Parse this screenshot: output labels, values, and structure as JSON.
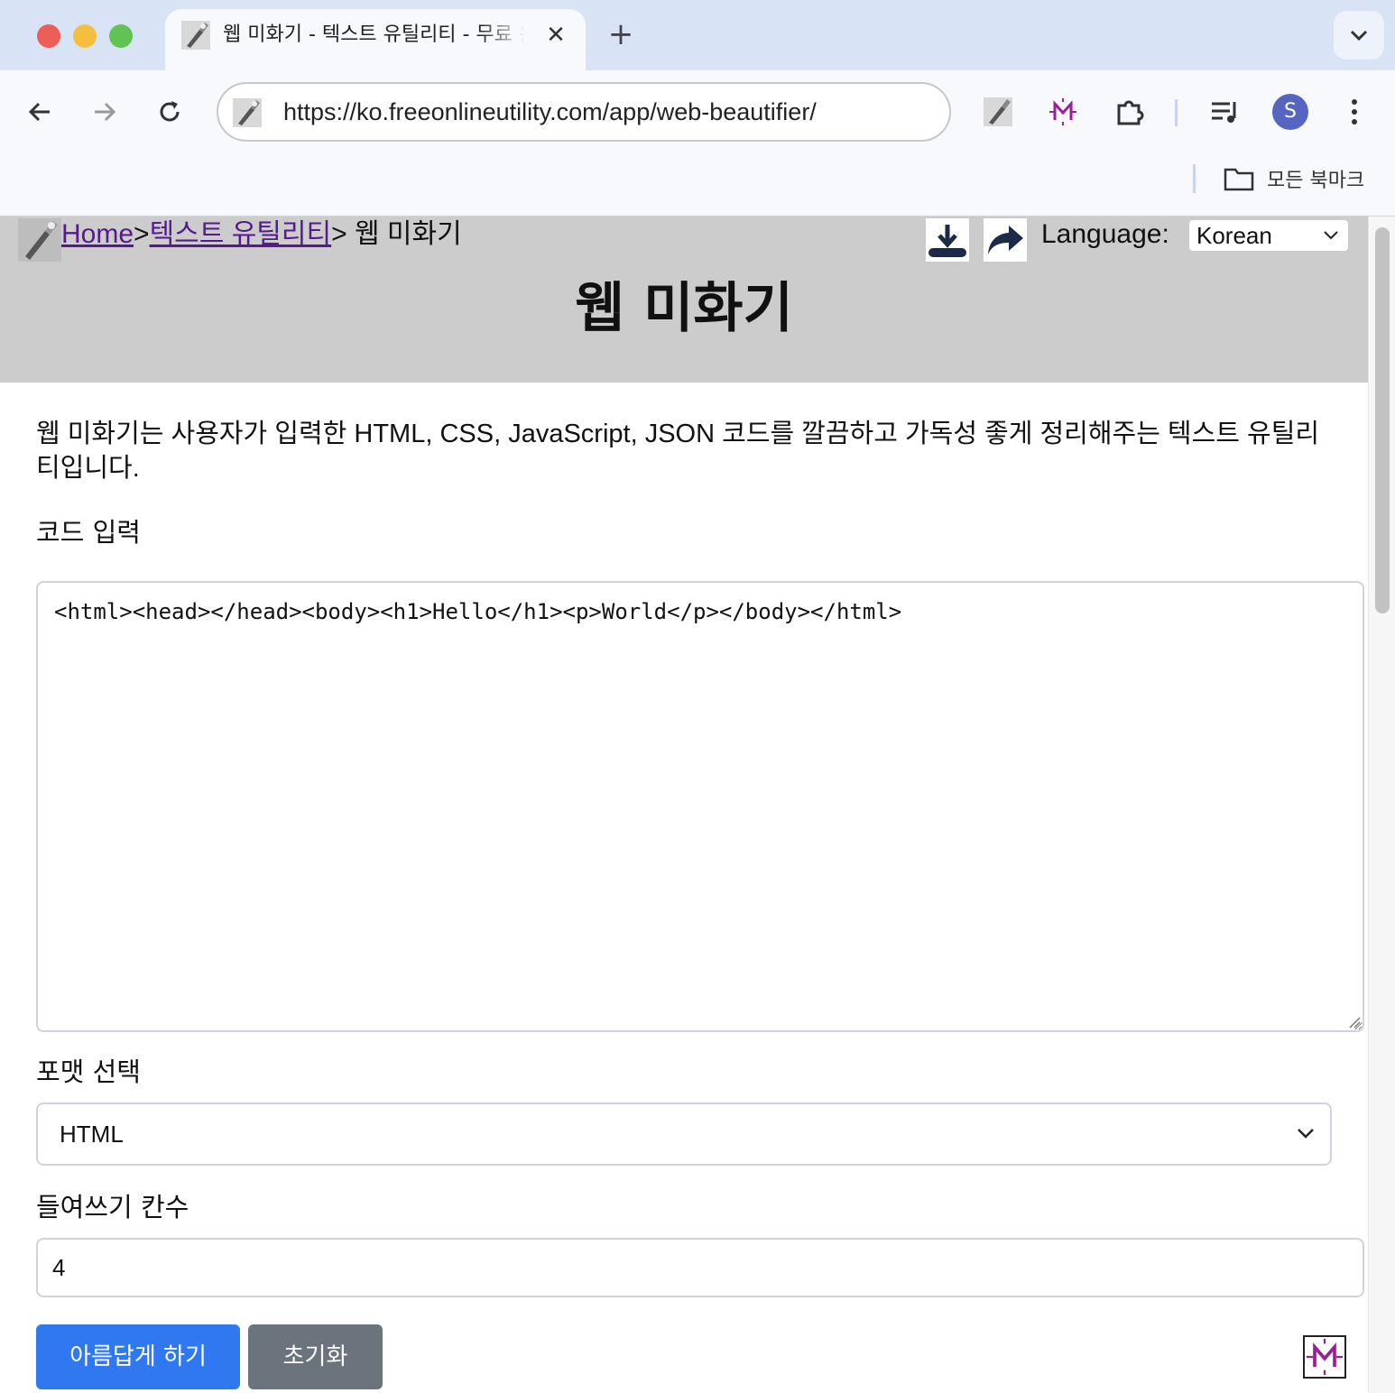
{
  "browser": {
    "tab_title": "웹 미화기 - 텍스트 유틸리티 - 무료 온라인 유틸리티",
    "close_glyph": "✕",
    "newtab_glyph": "+",
    "url": "https://ko.freeonlineutility.com/app/web-beautifier/",
    "avatar_letter": "S",
    "bookmarks_label": "모든 북마크"
  },
  "header": {
    "breadcrumb": {
      "home": "Home",
      "sep1": ">",
      "category": "텍스트 유틸리티",
      "current": "> 웹 미화기"
    },
    "language_label": "Language:",
    "language_value": "Korean",
    "title": "웹 미화기"
  },
  "main": {
    "intro": "웹 미화기는 사용자가 입력한 HTML, CSS, JavaScript, JSON 코드를 깔끔하고 가독성 좋게 정리해주는 텍스트 유틸리티입니다.",
    "code_label": "코드 입력",
    "code_value": "<html><head></head><body><h1>Hello</h1><p>World</p></body></html>",
    "format_label": "포맷 선택",
    "format_value": "HTML",
    "indent_label": "들여쓰기 칸수",
    "indent_value": "4",
    "beautify_button": "아름답게 하기",
    "reset_button": "초기화"
  },
  "colors": {
    "primary": "#2f78f0",
    "secondary": "#6b737c",
    "header_bg": "#cccccc",
    "link": "#551a8b",
    "tabstrip": "#d9e3f6"
  },
  "icons": [
    "wrench-icon",
    "back-arrow-icon",
    "forward-arrow-icon",
    "reload-icon",
    "extension-puzzle-icon",
    "media-queue-icon",
    "kebab-menu-icon",
    "folder-icon",
    "download-icon",
    "share-icon",
    "chevron-down-icon",
    "m-logo-icon"
  ]
}
